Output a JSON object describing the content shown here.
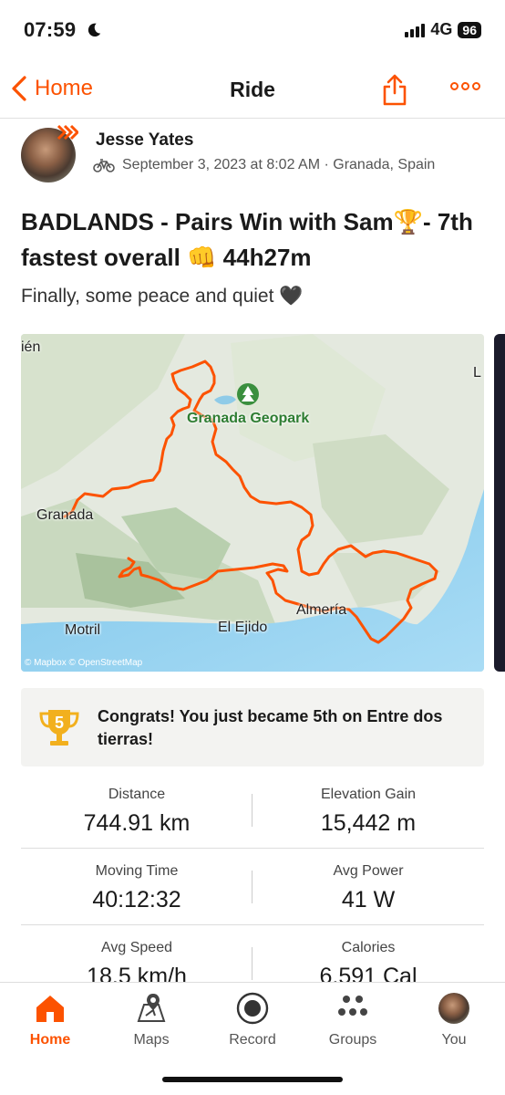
{
  "status_bar": {
    "time": "07:59",
    "network": "4G",
    "battery": "96"
  },
  "nav": {
    "back_label": "Home",
    "title": "Ride"
  },
  "activity": {
    "athlete_name": "Jesse Yates",
    "meta": "September 3, 2023 at 8:02 AM · Granada, Spain",
    "sport_icon": "bike-icon",
    "title": "BADLANDS - Pairs Win with Sam🏆- 7th fastest overall 👊 44h27m",
    "description": "Finally, some peace and quiet 🖤"
  },
  "map": {
    "labels": {
      "top_left": "ién",
      "top_right": "L",
      "geopark": "Granada Geopark",
      "granada": "Granada",
      "motril": "Motril",
      "el_ejido": "El Ejido",
      "almeria": "Almería"
    },
    "credit": "© Mapbox © OpenStreetMap",
    "route_color": "#fc5200"
  },
  "achievement": {
    "rank": "5",
    "text": "Congrats! You just became 5th on Entre dos tierras!"
  },
  "stats": [
    {
      "left": {
        "label": "Distance",
        "value": "744.91 km"
      },
      "right": {
        "label": "Elevation Gain",
        "value": "15,442 m"
      }
    },
    {
      "left": {
        "label": "Moving Time",
        "value": "40:12:32"
      },
      "right": {
        "label": "Avg Power",
        "value": "41 W"
      }
    },
    {
      "left": {
        "label": "Avg Speed",
        "value": "18.5 km/h"
      },
      "right": {
        "label": "Calories",
        "value": "6,591 Cal"
      }
    }
  ],
  "tabs": [
    {
      "label": "Home",
      "icon": "home-icon",
      "active": true
    },
    {
      "label": "Maps",
      "icon": "maps-icon",
      "active": false
    },
    {
      "label": "Record",
      "icon": "record-icon",
      "active": false
    },
    {
      "label": "Groups",
      "icon": "groups-icon",
      "active": false
    },
    {
      "label": "You",
      "icon": "avatar",
      "active": false
    }
  ],
  "colors": {
    "brand": "#fc5200",
    "text": "#1a1a1a",
    "muted": "#555555"
  }
}
